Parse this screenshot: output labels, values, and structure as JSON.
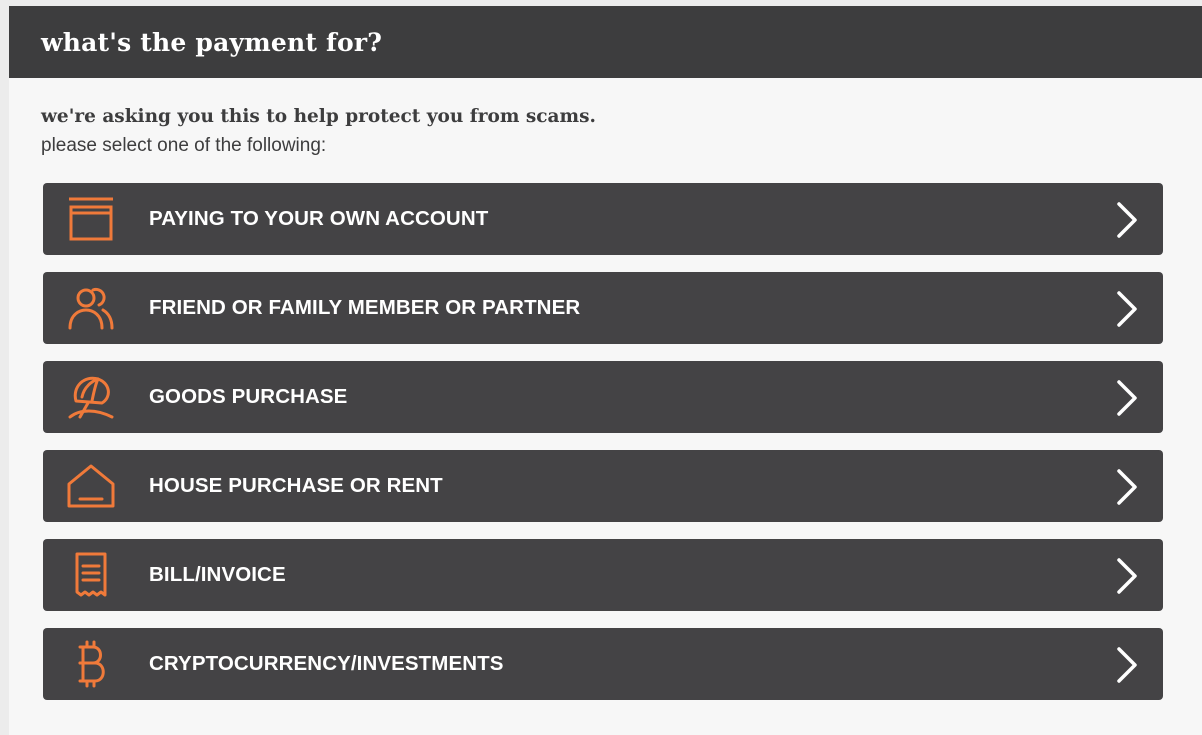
{
  "header": {
    "title": "what's the payment for?"
  },
  "intro": {
    "subtitle": "we're asking you this to help protect you from scams.",
    "instruction": "please select one of the following:"
  },
  "colors": {
    "accent": "#f07a3a",
    "button_bg": "#444345",
    "header_bg": "#3d3d3e",
    "text_light": "#ffffff"
  },
  "options": [
    {
      "label": "PAYING TO YOUR OWN ACCOUNT",
      "icon": "bank-card-icon"
    },
    {
      "label": "FRIEND OR FAMILY MEMBER OR PARTNER",
      "icon": "people-icon"
    },
    {
      "label": "GOODS PURCHASE",
      "icon": "beach-umbrella-icon"
    },
    {
      "label": "HOUSE PURCHASE OR RENT",
      "icon": "house-icon"
    },
    {
      "label": "BILL/INVOICE",
      "icon": "receipt-icon"
    },
    {
      "label": "CRYPTOCURRENCY/INVESTMENTS",
      "icon": "bitcoin-icon"
    }
  ]
}
